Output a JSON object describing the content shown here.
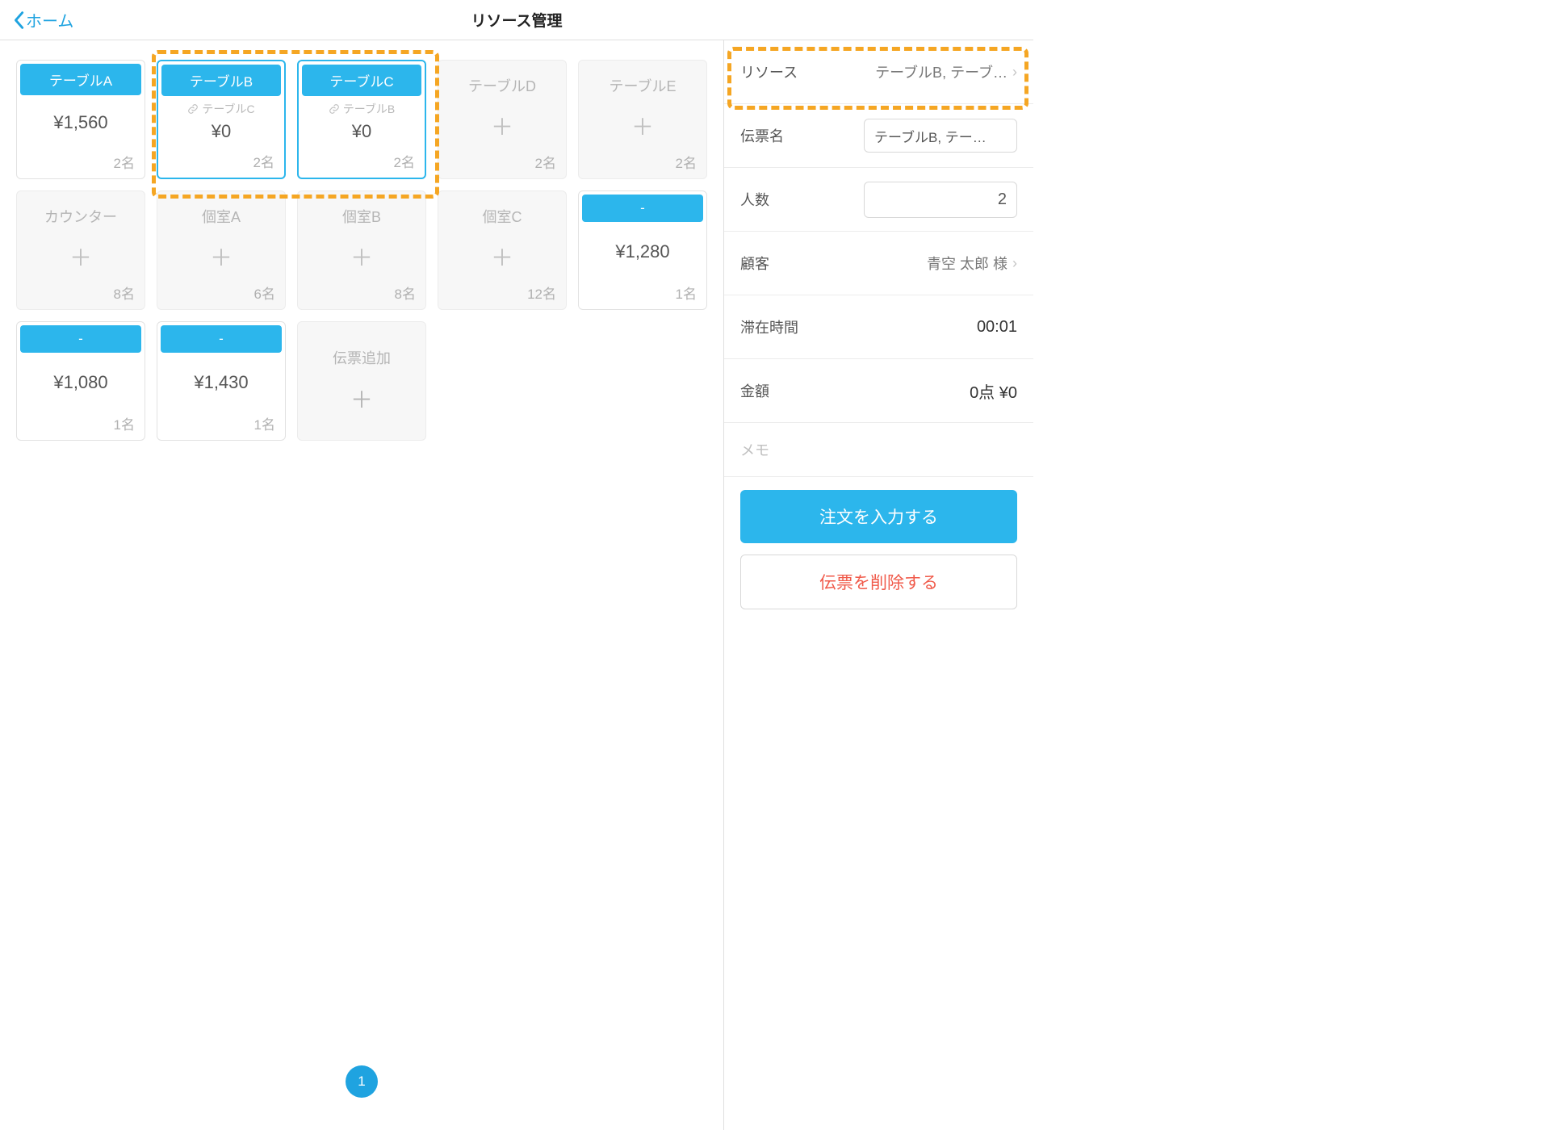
{
  "header": {
    "back_label": "ホーム",
    "title": "リソース管理"
  },
  "cards": [
    {
      "type": "occupied",
      "name": "テーブルA",
      "amount": "¥1,560",
      "people": "2名",
      "selected": false,
      "linked": ""
    },
    {
      "type": "occupied",
      "name": "テーブルB",
      "amount": "¥0",
      "people": "2名",
      "selected": true,
      "linked": "テーブルC"
    },
    {
      "type": "occupied",
      "name": "テーブルC",
      "amount": "¥0",
      "people": "2名",
      "selected": true,
      "linked": "テーブルB"
    },
    {
      "type": "empty",
      "name": "テーブルD",
      "people": "2名"
    },
    {
      "type": "empty",
      "name": "テーブルE",
      "people": "2名"
    },
    {
      "type": "empty",
      "name": "カウンター",
      "people": "8名"
    },
    {
      "type": "empty",
      "name": "個室A",
      "people": "6名"
    },
    {
      "type": "empty",
      "name": "個室B",
      "people": "8名"
    },
    {
      "type": "empty",
      "name": "個室C",
      "people": "12名"
    },
    {
      "type": "occupied",
      "name": "-",
      "amount": "¥1,280",
      "people": "1名",
      "selected": false,
      "linked": ""
    },
    {
      "type": "occupied",
      "name": "-",
      "amount": "¥1,080",
      "people": "1名",
      "selected": false,
      "linked": ""
    },
    {
      "type": "occupied",
      "name": "-",
      "amount": "¥1,430",
      "people": "1名",
      "selected": false,
      "linked": ""
    },
    {
      "type": "add",
      "name": "伝票追加"
    }
  ],
  "pager": {
    "current": "1"
  },
  "sidebar": {
    "resource": {
      "label": "リソース",
      "value": "テーブルB, テーブ…"
    },
    "slip_name": {
      "label": "伝票名",
      "value": "テーブルB, テー…"
    },
    "people": {
      "label": "人数",
      "value": "2"
    },
    "customer": {
      "label": "顧客",
      "value": "青空 太郎 様"
    },
    "duration": {
      "label": "滞在時間",
      "value": "00:01"
    },
    "amount": {
      "label": "金額",
      "value": "0点  ¥0"
    },
    "memo_placeholder": "メモ",
    "order_btn": "注文を入力する",
    "delete_btn": "伝票を削除する"
  }
}
